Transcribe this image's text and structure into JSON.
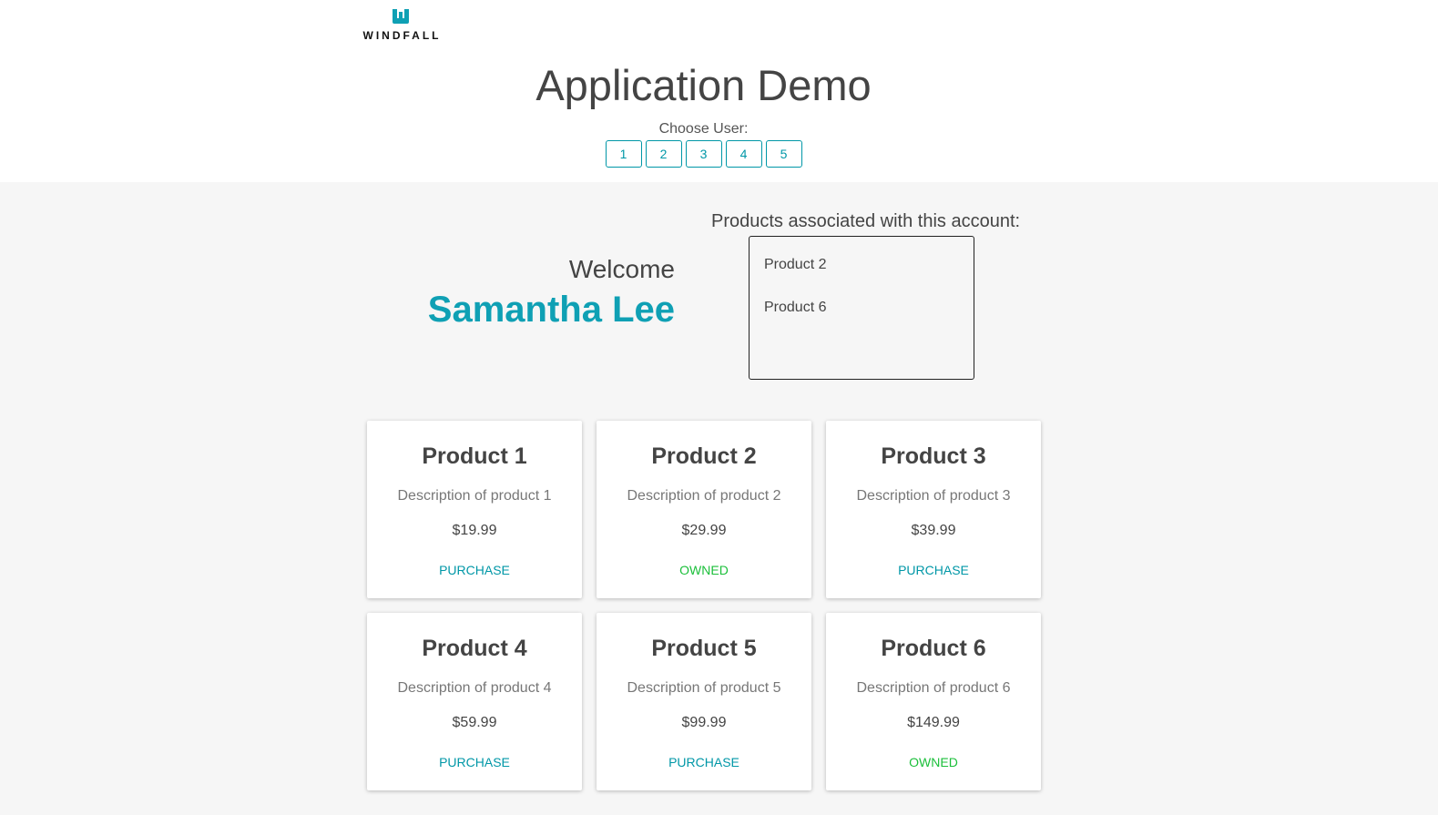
{
  "brand": {
    "name": "WINDFALL",
    "icon": "windfall-logo-icon",
    "color": "#0fa0b4"
  },
  "header": {
    "title": "Application Demo",
    "choose_label": "Choose User:",
    "users": [
      "1",
      "2",
      "3",
      "4",
      "5"
    ]
  },
  "account": {
    "welcome": "Welcome",
    "name": "Samantha Lee",
    "products_label": "Products associated with this account:",
    "products": [
      "Product 2",
      "Product 6"
    ]
  },
  "products": [
    {
      "title": "Product 1",
      "description": "Description of product 1",
      "price": "$19.99",
      "action": "PURCHASE",
      "status": "purchase"
    },
    {
      "title": "Product 2",
      "description": "Description of product 2",
      "price": "$29.99",
      "action": "OWNED",
      "status": "owned"
    },
    {
      "title": "Product 3",
      "description": "Description of product 3",
      "price": "$39.99",
      "action": "PURCHASE",
      "status": "purchase"
    },
    {
      "title": "Product 4",
      "description": "Description of product 4",
      "price": "$59.99",
      "action": "PURCHASE",
      "status": "purchase"
    },
    {
      "title": "Product 5",
      "description": "Description of product 5",
      "price": "$99.99",
      "action": "PURCHASE",
      "status": "purchase"
    },
    {
      "title": "Product 6",
      "description": "Description of product 6",
      "price": "$149.99",
      "action": "OWNED",
      "status": "owned"
    }
  ],
  "colors": {
    "accent": "#0097a7",
    "owned": "#1bbf3a",
    "background": "#f6f6f6"
  }
}
